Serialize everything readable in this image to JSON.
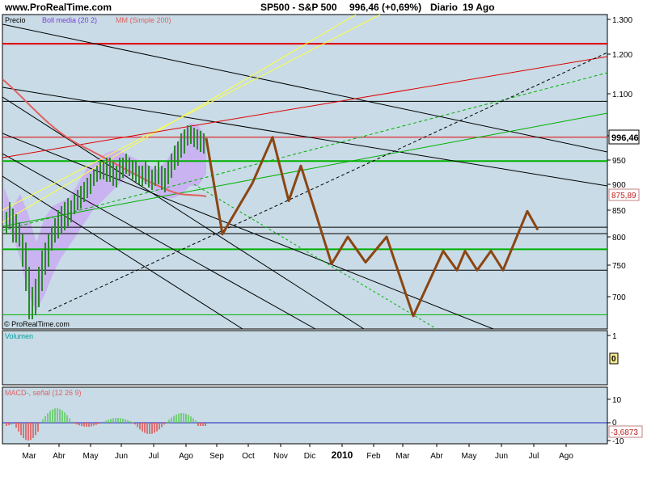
{
  "header": {
    "site": "www.ProRealTime.com",
    "title": "SP500 - S&P 500",
    "last": "996,46 (+0,69%)",
    "period": "Diario",
    "date": "19 Ago"
  },
  "legend": {
    "precio": "Precio",
    "boll": "Boll media (20 2)",
    "mm": "MM (Simple 200)"
  },
  "watermark": "© ProRealTime.com",
  "price_labels": {
    "last": "996,46",
    "ma": "875,89"
  },
  "volume": {
    "label": "Volumen",
    "scale_top": "1",
    "value": "0"
  },
  "macd": {
    "label": "MACD-, señal (12 26 9)",
    "ticks": [
      "10",
      "0",
      "-10"
    ],
    "value": "-3,6873"
  },
  "colors": {
    "panel_bg": "#c8dbe6",
    "bollinger_fill": "#c9b3f0",
    "price": "#8b4513",
    "ma200": "#e06060",
    "macd_hist": "#5ac85a",
    "macd_neg": "#e05050",
    "grid_red": "#e00000",
    "grid_green": "#00b000"
  },
  "chart_data": {
    "type": "line",
    "title": "SP500 - S&P 500",
    "y_axis": {
      "ticks": [
        1300,
        1200,
        1100,
        1000,
        950,
        900,
        850,
        800,
        750,
        700
      ],
      "tick_labels": [
        "1.300",
        "1.200",
        "1.100",
        "1.000",
        "950",
        "900",
        "850",
        "800",
        "750",
        "700"
      ],
      "range": [
        640,
        1310
      ]
    },
    "x_axis": {
      "tick_labels": [
        "Mar",
        "Abr",
        "May",
        "Jun",
        "Jul",
        "Ago",
        "Sep",
        "Oct",
        "Nov",
        "Dic",
        "2010",
        "Feb",
        "Mar",
        "Abr",
        "May",
        "Jun",
        "Jul",
        "Ago"
      ]
    },
    "horizontal_levels": [
      {
        "value": 1230,
        "color": "red"
      },
      {
        "value": 1082,
        "color": "black"
      },
      {
        "value": 997,
        "color": "red"
      },
      {
        "value": 948,
        "color": "green"
      },
      {
        "value": 818,
        "color": "black"
      },
      {
        "value": 806,
        "color": "black"
      },
      {
        "value": 778,
        "color": "green"
      },
      {
        "value": 742,
        "color": "black"
      },
      {
        "value": 672,
        "color": "green"
      }
    ],
    "projection": {
      "name": "",
      "x": [
        "Ago",
        "Sep",
        "Oct",
        "Nov",
        "Nov",
        "Dic",
        "Dic",
        "Ene",
        "Ene",
        "Feb",
        "Mar",
        "Abr",
        "Abr",
        "May",
        "May",
        "Jun",
        "Jun",
        "Jul",
        "Jul"
      ],
      "values": [
        995,
        805,
        902,
        997,
        868,
        938,
        752,
        800,
        755,
        800,
        670,
        775,
        742,
        775,
        742,
        775,
        742,
        848,
        813
      ]
    },
    "macd_series": {
      "name": "MACD",
      "last": -3.6873
    }
  }
}
